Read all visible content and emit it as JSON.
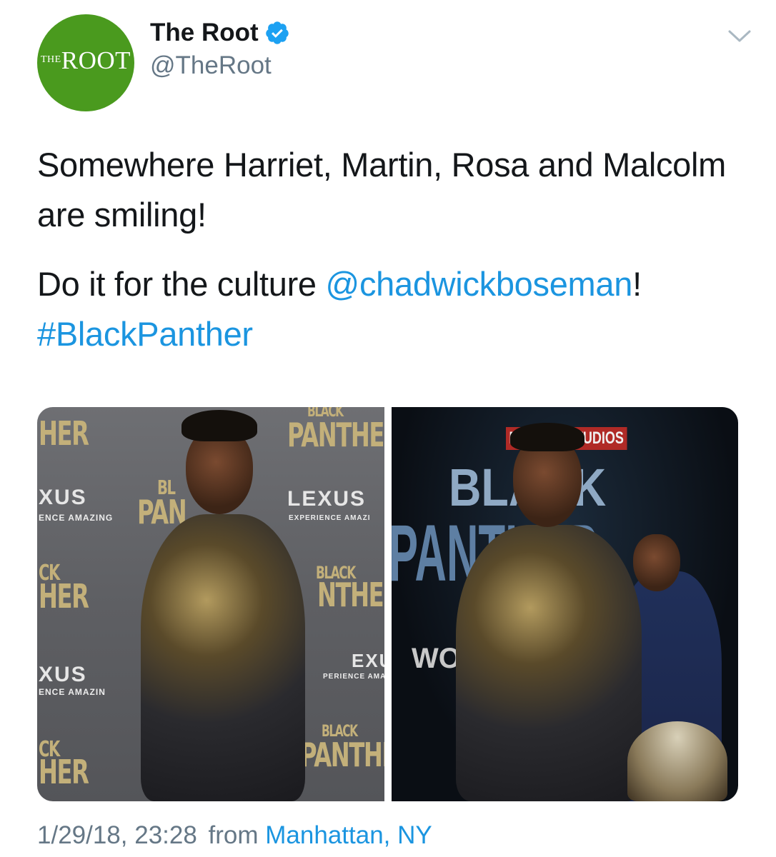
{
  "account": {
    "display_name": "The Root",
    "handle": "@TheRoot",
    "avatar_text_small": "THE",
    "avatar_text_large": "ROOT",
    "verified": true,
    "avatar_color": "#4a9a1e",
    "verified_color": "#1da1f2"
  },
  "tweet": {
    "line1": "Somewhere Harriet, Martin, Rosa and Malcolm are smiling!",
    "line2_text": "Do it for the culture ",
    "mention": "@chadwickboseman",
    "line2_end": "!",
    "hashtag": "#BlackPanther",
    "link_color": "#1b95e0"
  },
  "media": {
    "photo1": {
      "backdrop_texts": [
        "HER",
        "BLACK",
        "PANTHER",
        "XUS",
        "ENCE AMAZING",
        "LEXUS",
        "EXPERIENCE AMAZI",
        "BL",
        "PAN",
        "CK",
        "HER",
        "BLACK",
        "NTHER",
        "EXU",
        "PERIENCE AMAZ",
        "XUS",
        "ENCE AMAZIN",
        "BLACK",
        "PANTHER",
        "CK",
        "HER"
      ]
    },
    "photo2": {
      "backdrop_texts": [
        "MARVEL STUDIOS",
        "BLACK",
        "PANTHER",
        "WO"
      ]
    }
  },
  "footer": {
    "timestamp": "1/29/18, 23:28",
    "from_label": "from",
    "location": "Manhattan, NY"
  },
  "icons": {
    "verified": "verified-badge-icon",
    "menu": "chevron-down-icon"
  }
}
